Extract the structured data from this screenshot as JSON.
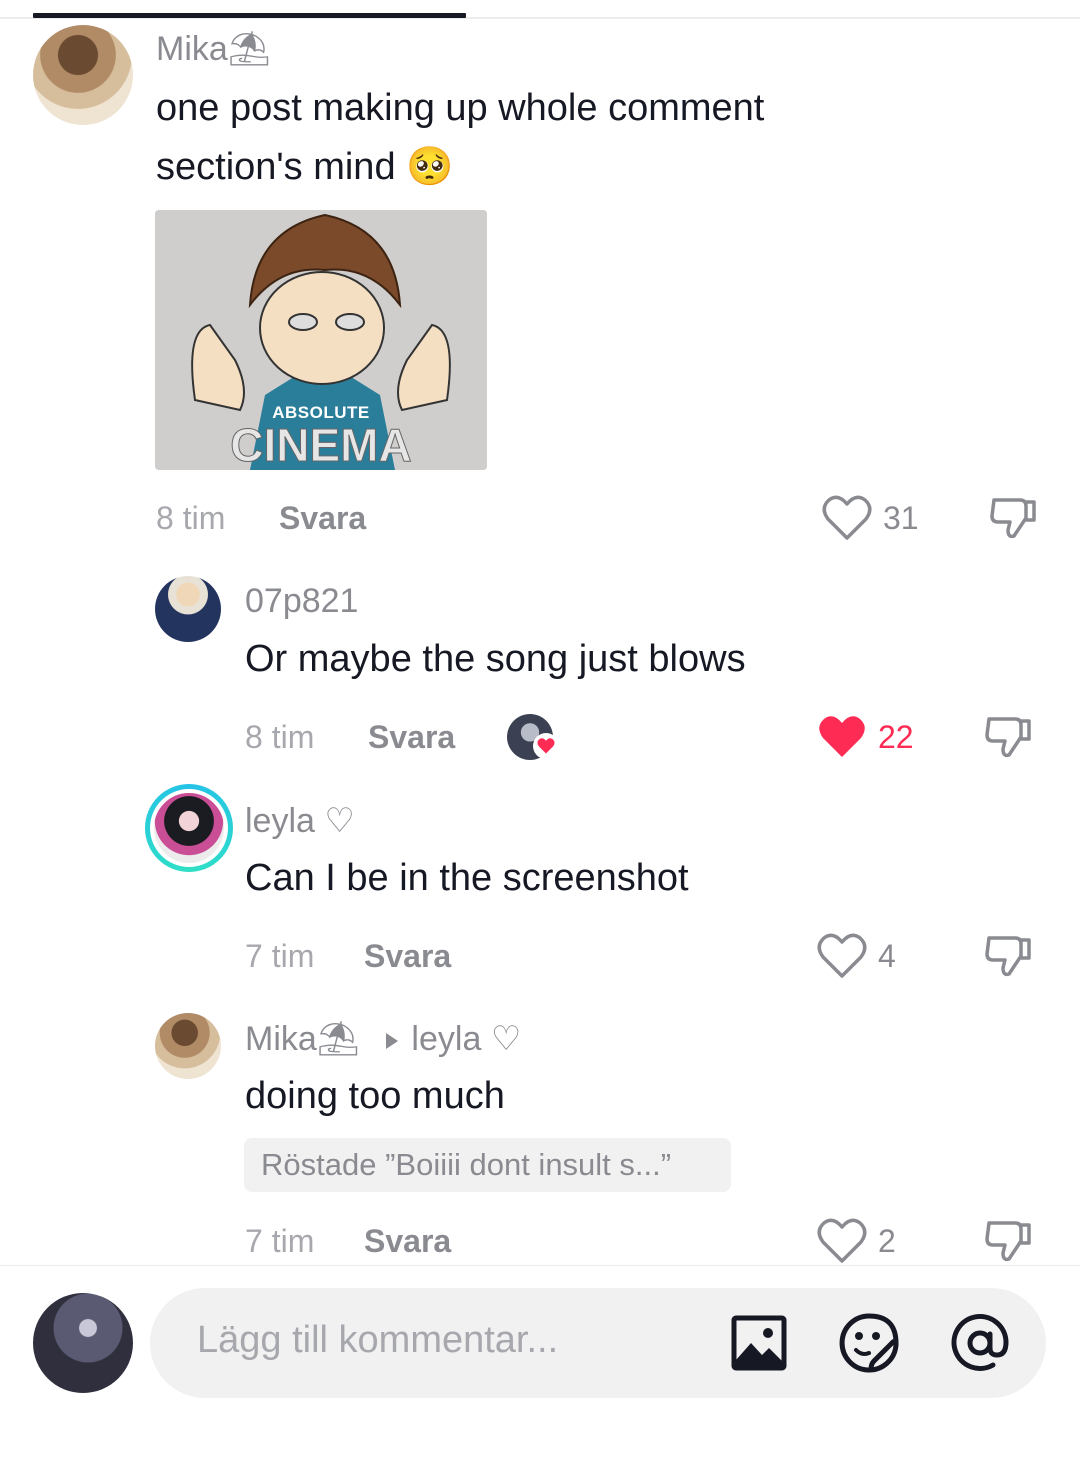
{
  "colors": {
    "text": "#161823",
    "muted": "#8a8b91",
    "like_red": "#fe2c55",
    "ring": "#25c2e8"
  },
  "comments": [
    {
      "username": "Mika",
      "username_emoji": "⛱",
      "text_line1": "one post making up whole comment",
      "text_line2": "section's mind",
      "text_emoji": "🥺",
      "gif_caption_small": "ABSOLUTE",
      "gif_caption_big": "CINEMA",
      "time": "8 tim",
      "reply_label": "Svara",
      "likes": "31",
      "liked": false
    },
    {
      "username": "07p821",
      "text": "Or maybe the song just blows",
      "time": "8 tim",
      "reply_label": "Svara",
      "likes": "22",
      "liked": true,
      "liked_by_creator": true
    },
    {
      "username": "leyla",
      "username_suffix": "♡",
      "text": "Can I be in the screenshot",
      "time": "7 tim",
      "reply_label": "Svara",
      "likes": "4",
      "liked": false
    },
    {
      "username": "Mika",
      "username_emoji": "⛱",
      "reply_to": "leyla",
      "reply_to_suffix": "♡",
      "text": "doing too much",
      "voted_chip": "Röstade ”Boiiii dont insult s...”",
      "time": "7 tim",
      "reply_label": "Svara",
      "likes": "2",
      "liked": false
    }
  ],
  "composer": {
    "placeholder": "Lägg till kommentar...",
    "icons": [
      "image-icon",
      "sticker-icon",
      "mention-icon"
    ]
  }
}
